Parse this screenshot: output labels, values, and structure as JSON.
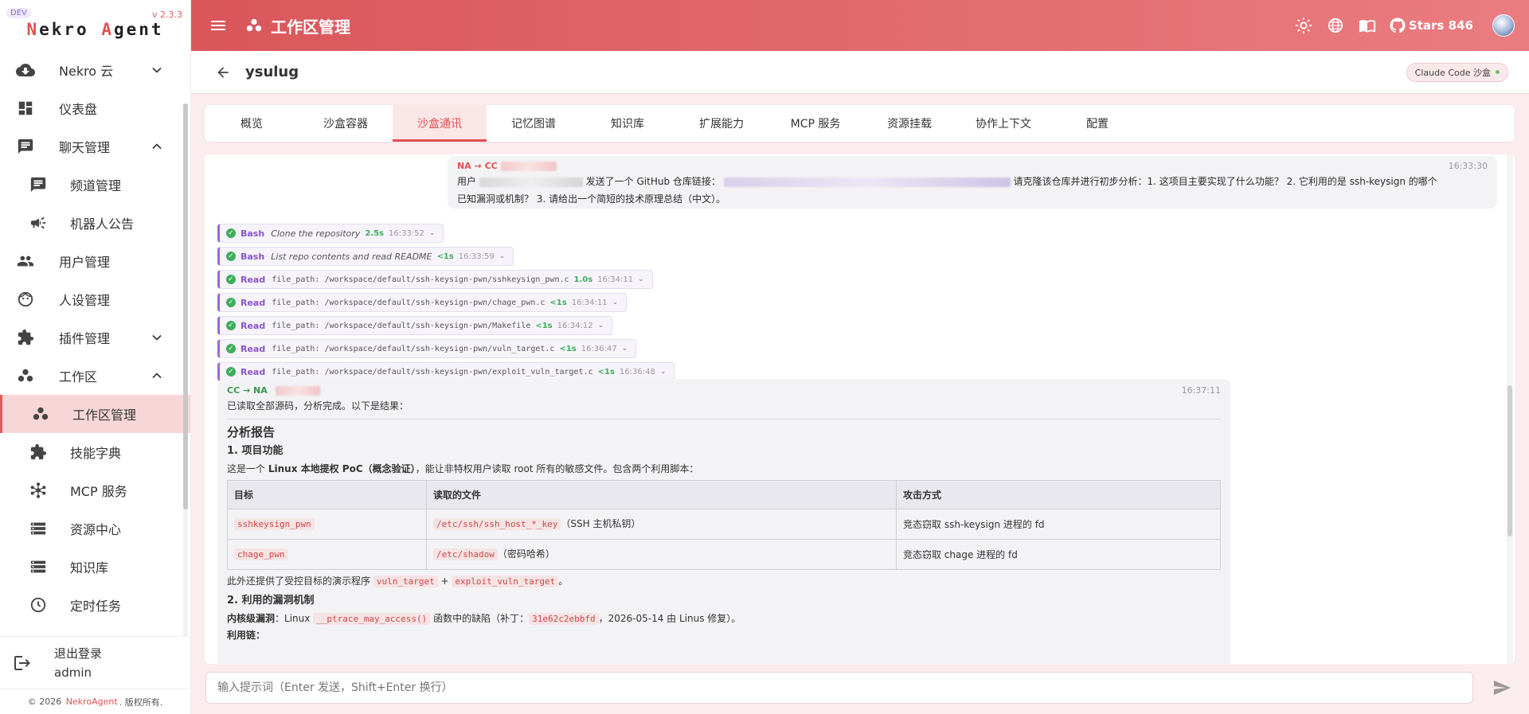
{
  "brand": {
    "dev": "DEV",
    "version": "v 2.3.3",
    "logo_first": "N",
    "logo_mid1": "ekro ",
    "logo_second": "A",
    "logo_mid2": "gent"
  },
  "sidebar": {
    "items": [
      {
        "label": "Nekro 云",
        "icon": "cloud-download-icon"
      },
      {
        "label": "仪表盘",
        "icon": "dashboard-icon"
      },
      {
        "label": "聊天管理",
        "icon": "chat-icon"
      },
      {
        "label": "频道管理",
        "icon": "chat-icon"
      },
      {
        "label": "机器人公告",
        "icon": "campaign-icon"
      },
      {
        "label": "用户管理",
        "icon": "people-icon"
      },
      {
        "label": "人设管理",
        "icon": "face-icon"
      },
      {
        "label": "插件管理",
        "icon": "extension-icon"
      },
      {
        "label": "工作区",
        "icon": "workspaces-icon"
      },
      {
        "label": "工作区管理",
        "icon": "workspaces-icon"
      },
      {
        "label": "技能字典",
        "icon": "extension-icon"
      },
      {
        "label": "MCP 服务",
        "icon": "hub-icon"
      },
      {
        "label": "资源中心",
        "icon": "storage-icon"
      },
      {
        "label": "知识库",
        "icon": "storage-icon"
      },
      {
        "label": "定时任务",
        "icon": "clock-icon"
      }
    ],
    "logout_label": "退出登录",
    "username": "admin",
    "copyright_pre": "© 2026",
    "copyright_brand": "NekroAgent",
    "copyright_post": ". 版权所有."
  },
  "topbar": {
    "title": "工作区管理",
    "stars": "Stars 846"
  },
  "workspace": {
    "name": "ysulug",
    "badge": "Claude Code 沙盒"
  },
  "tabs": [
    "概览",
    "沙盒容器",
    "沙盒通讯",
    "记忆图谱",
    "知识库",
    "扩展能力",
    "MCP 服务",
    "资源挂载",
    "协作上下文",
    "配置"
  ],
  "user_msg": {
    "direction": "NA → CC",
    "time": "16:33:30",
    "prefix": "用户",
    "mid": "发送了一个 GitHub 仓库链接：",
    "request": "请克隆该仓库并进行初步分析：1. 这项目主要实现了什么功能？ 2. 它利用的是 ssh-keysign 的哪个",
    "request2": "已知漏洞或机制？ 3. 请给出一个简短的技术原理总结（中文）。"
  },
  "tools": [
    {
      "name": "Bash",
      "desc": "Clone the repository",
      "dur": "2.5s",
      "time": "16:33:52"
    },
    {
      "name": "Bash",
      "desc": "List repo contents and read README",
      "dur": "<1s",
      "time": "16:33:59"
    },
    {
      "name": "Read",
      "path": "file_path: /workspace/default/ssh-keysign-pwn/sshkeysign_pwn.c",
      "dur": "1.0s",
      "time": "16:34:11"
    },
    {
      "name": "Read",
      "path": "file_path: /workspace/default/ssh-keysign-pwn/chage_pwn.c",
      "dur": "<1s",
      "time": "16:34:11"
    },
    {
      "name": "Read",
      "path": "file_path: /workspace/default/ssh-keysign-pwn/Makefile",
      "dur": "<1s",
      "time": "16:34:12"
    },
    {
      "name": "Read",
      "path": "file_path: /workspace/default/ssh-keysign-pwn/vuln_target.c",
      "dur": "<1s",
      "time": "16:36:47"
    },
    {
      "name": "Read",
      "path": "file_path: /workspace/default/ssh-keysign-pwn/exploit_vuln_target.c",
      "dur": "<1s",
      "time": "16:36:48"
    }
  ],
  "cc_msg": {
    "direction": "CC → NA",
    "time": "16:37:11",
    "intro": "已读取全部源码，分析完成。以下是结果：",
    "h_report": "分析报告",
    "h_func": "1. 项目功能",
    "func_pre": "这是一个",
    "func_bold": "Linux 本地提权 PoC（概念验证）",
    "func_post": "，能让非特权用户读取 root 所有的敏感文件。包含两个利用脚本：",
    "table_headers": [
      "目标",
      "读取的文件",
      "攻击方式"
    ],
    "rows": [
      {
        "target": "sshkeysign_pwn",
        "file": "/etc/ssh/ssh_host_*_key",
        "file_note": "（SSH 主机私钥）",
        "method": "竞态窃取 ssh-keysign 进程的 fd"
      },
      {
        "target": "chage_pwn",
        "file": "/etc/shadow",
        "file_note": "（密码哈希）",
        "method": "竞态窃取 chage 进程的 fd"
      }
    ],
    "extra_pre": "此外还提供了受控目标的演示程序",
    "extra_code1": "vuln_target",
    "extra_plus": "+",
    "extra_code2": "exploit_vuln_target",
    "extra_post": "。",
    "h_vuln": "2. 利用的漏洞机制",
    "vuln_bold": "内核级漏洞",
    "vuln_pre": "：Linux",
    "vuln_code": "__ptrace_may_access()",
    "vuln_mid": "函数中的缺陷（补丁：",
    "vuln_patch": "31e62c2ebbfd",
    "vuln_post": "，2026-05-14 由 Linus 修复）。",
    "cut_line": "利用链："
  },
  "input": {
    "placeholder": "输入提示词（Enter 发送，Shift+Enter 换行）"
  },
  "colors": {
    "accent": "#e05050",
    "tool_accent": "#9a6ad6",
    "success": "#3fae5c"
  }
}
